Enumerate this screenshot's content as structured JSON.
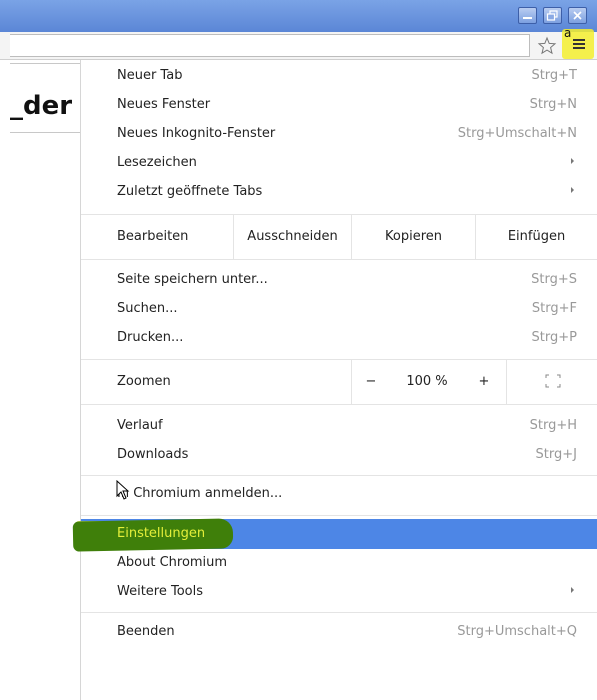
{
  "window_controls": {
    "minimize": "minimize-icon",
    "restore": "restore-icon",
    "close": "close-icon"
  },
  "toolbar": {
    "bookmark_icon": "star-icon",
    "menu_icon": "hamburger-menu-icon",
    "annotation": "a"
  },
  "page_behind": {
    "text_fragment": "_der"
  },
  "menu": {
    "items_top": [
      {
        "label": "Neuer Tab",
        "shortcut": "Strg+T"
      },
      {
        "label": "Neues Fenster",
        "shortcut": "Strg+N"
      },
      {
        "label": "Neues Inkognito-Fenster",
        "shortcut": "Strg+Umschalt+N"
      },
      {
        "label": "Lesezeichen",
        "submenu": true
      },
      {
        "label": "Zuletzt geöffnete Tabs",
        "submenu": true
      }
    ],
    "edit_row": {
      "label": "Bearbeiten",
      "cut": "Ausschneiden",
      "copy": "Kopieren",
      "paste": "Einfügen"
    },
    "items_file": [
      {
        "label": "Seite speichern unter...",
        "shortcut": "Strg+S"
      },
      {
        "label": "Suchen...",
        "shortcut": "Strg+F"
      },
      {
        "label": "Drucken...",
        "shortcut": "Strg+P"
      }
    ],
    "zoom_row": {
      "label": "Zoomen",
      "minus": "−",
      "value": "100 %",
      "plus": "+",
      "fullscreen_icon": "fullscreen-icon"
    },
    "items_history": [
      {
        "label": "Verlauf",
        "shortcut": "Strg+H"
      },
      {
        "label": "Downloads",
        "shortcut": "Strg+J"
      }
    ],
    "signin": {
      "label": "In Chromium anmelden..."
    },
    "items_settings": [
      {
        "label": "Einstellungen",
        "selected": true
      },
      {
        "label": "About Chromium"
      },
      {
        "label": "Weitere Tools",
        "submenu": true
      }
    ],
    "quit": {
      "label": "Beenden",
      "shortcut": "Strg+Umschalt+Q"
    }
  },
  "colors": {
    "selection": "#4d86e6",
    "highlight_yellow": "#f3ef2e",
    "highlight_green": "#3f7f0a",
    "titlebar": "#5b86d6"
  }
}
